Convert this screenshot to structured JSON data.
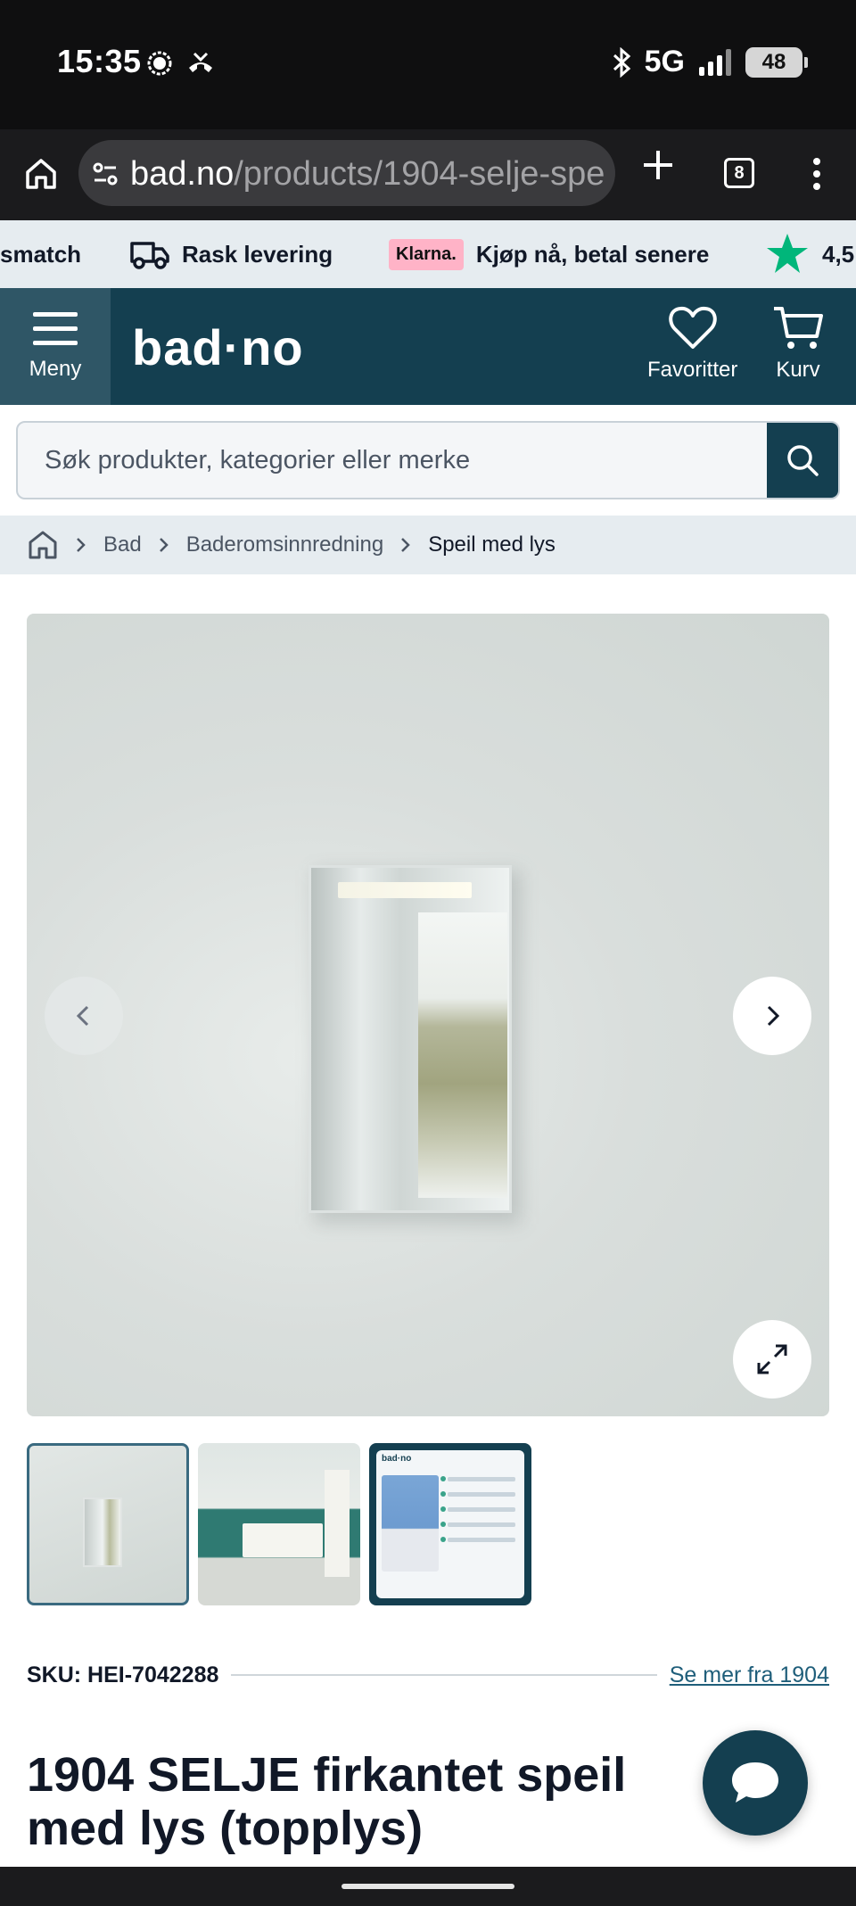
{
  "status_bar": {
    "time": "15:35",
    "network": "5G",
    "battery": "48",
    "icons": [
      "signal-messenger-icon",
      "missed-call-icon",
      "bluetooth-icon",
      "cell-signal-icon",
      "battery-icon"
    ]
  },
  "browser": {
    "url_domain": "bad.no",
    "url_path": "/products/1904-selje-spe",
    "tab_count": "8"
  },
  "usp": {
    "item1": "smatch",
    "item2": "Rask levering",
    "klarna_badge": "Klarna.",
    "item3": "Kjøp nå, betal senere",
    "item4": "4,5"
  },
  "header": {
    "menu_label": "Meny",
    "logo": "bad·no",
    "favorites_label": "Favoritter",
    "cart_label": "Kurv"
  },
  "search": {
    "placeholder": "Søk produkter, kategorier eller merke"
  },
  "breadcrumb": {
    "items": [
      "Bad",
      "Baderomsinnredning",
      "Speil med lys"
    ]
  },
  "gallery": {
    "thumbnail_count": 3,
    "active_index": 0,
    "thumb3_header": "bad·no"
  },
  "product": {
    "sku": "SKU: HEI-7042288",
    "brand_link": "Se mer fra 1904",
    "title": "1904 SELJE firkantet speil med lys (topplys)"
  },
  "colors": {
    "brand_dark": "#143f50",
    "usp_bg": "#e6ecf0",
    "star_green": "#00b67a",
    "klarna_pink": "#ffb3c7",
    "link": "#1f5e7a"
  }
}
